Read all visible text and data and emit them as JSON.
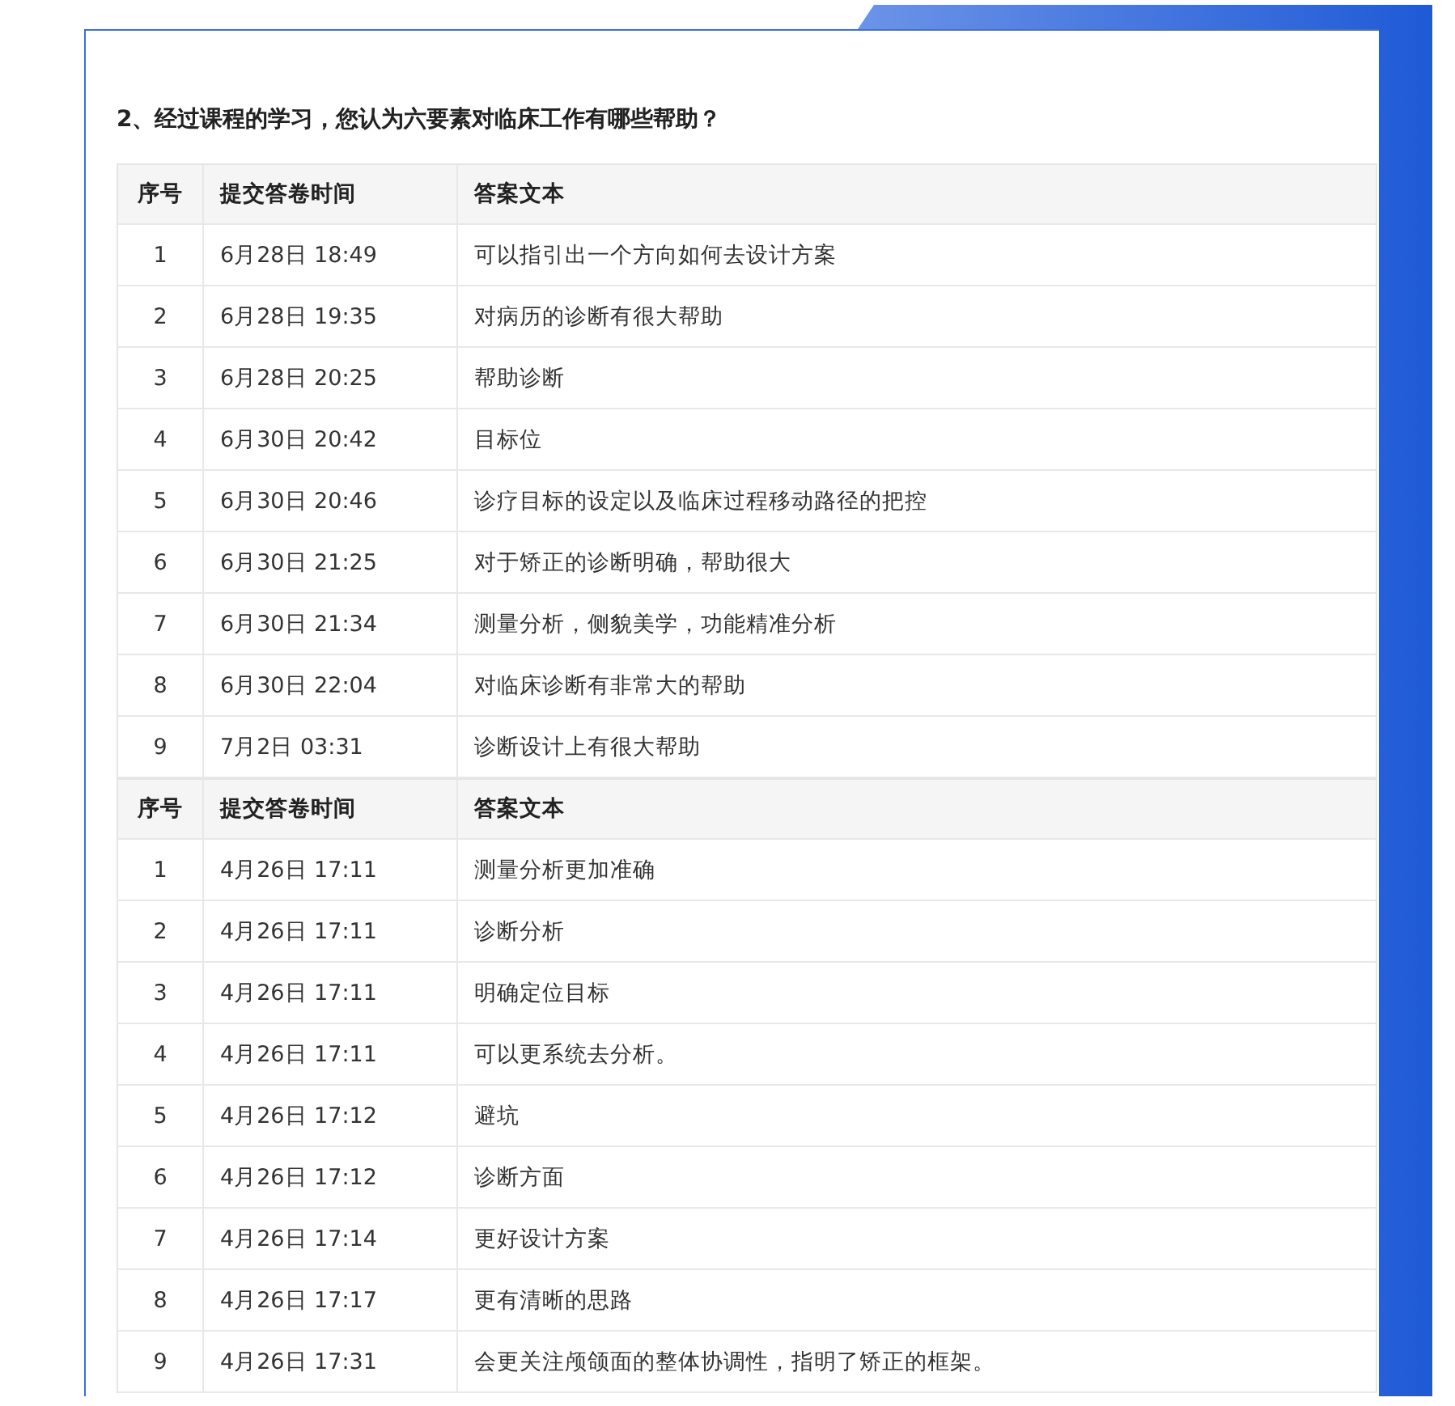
{
  "question": "2、经过课程的学习，您认为六要素对临床工作有哪些帮助？",
  "tables": [
    {
      "columns": [
        "序号",
        "提交答卷时间",
        "答案文本"
      ],
      "rows": [
        [
          "1",
          "6月28日 18:49",
          "可以指引出一个方向如何去设计方案"
        ],
        [
          "2",
          "6月28日 19:35",
          "对病历的诊断有很大帮助"
        ],
        [
          "3",
          "6月28日 20:25",
          "帮助诊断"
        ],
        [
          "4",
          "6月30日 20:42",
          "目标位"
        ],
        [
          "5",
          "6月30日 20:46",
          "诊疗目标的设定以及临床过程移动路径的把控"
        ],
        [
          "6",
          "6月30日 21:25",
          "对于矫正的诊断明确，帮助很大"
        ],
        [
          "7",
          "6月30日 21:34",
          "测量分析，侧貌美学，功能精准分析"
        ],
        [
          "8",
          "6月30日 22:04",
          "对临床诊断有非常大的帮助"
        ],
        [
          "9",
          "7月2日 03:31",
          "诊断设计上有很大帮助"
        ]
      ]
    },
    {
      "columns": [
        "序号",
        "提交答卷时间",
        "答案文本"
      ],
      "rows": [
        [
          "1",
          "4月26日 17:11",
          "测量分析更加准确"
        ],
        [
          "2",
          "4月26日 17:11",
          "诊断分析"
        ],
        [
          "3",
          "4月26日 17:11",
          "明确定位目标"
        ],
        [
          "4",
          "4月26日 17:11",
          "可以更系统去分析。"
        ],
        [
          "5",
          "4月26日 17:12",
          "避坑"
        ],
        [
          "6",
          "4月26日 17:12",
          "诊断方面"
        ],
        [
          "7",
          "4月26日 17:14",
          "更好设计方案"
        ],
        [
          "8",
          "4月26日 17:17",
          "更有清晰的思路"
        ],
        [
          "9",
          "4月26日 17:31",
          "会更关注颅颌面的整体协调性，指明了矫正的框架。"
        ]
      ]
    }
  ]
}
